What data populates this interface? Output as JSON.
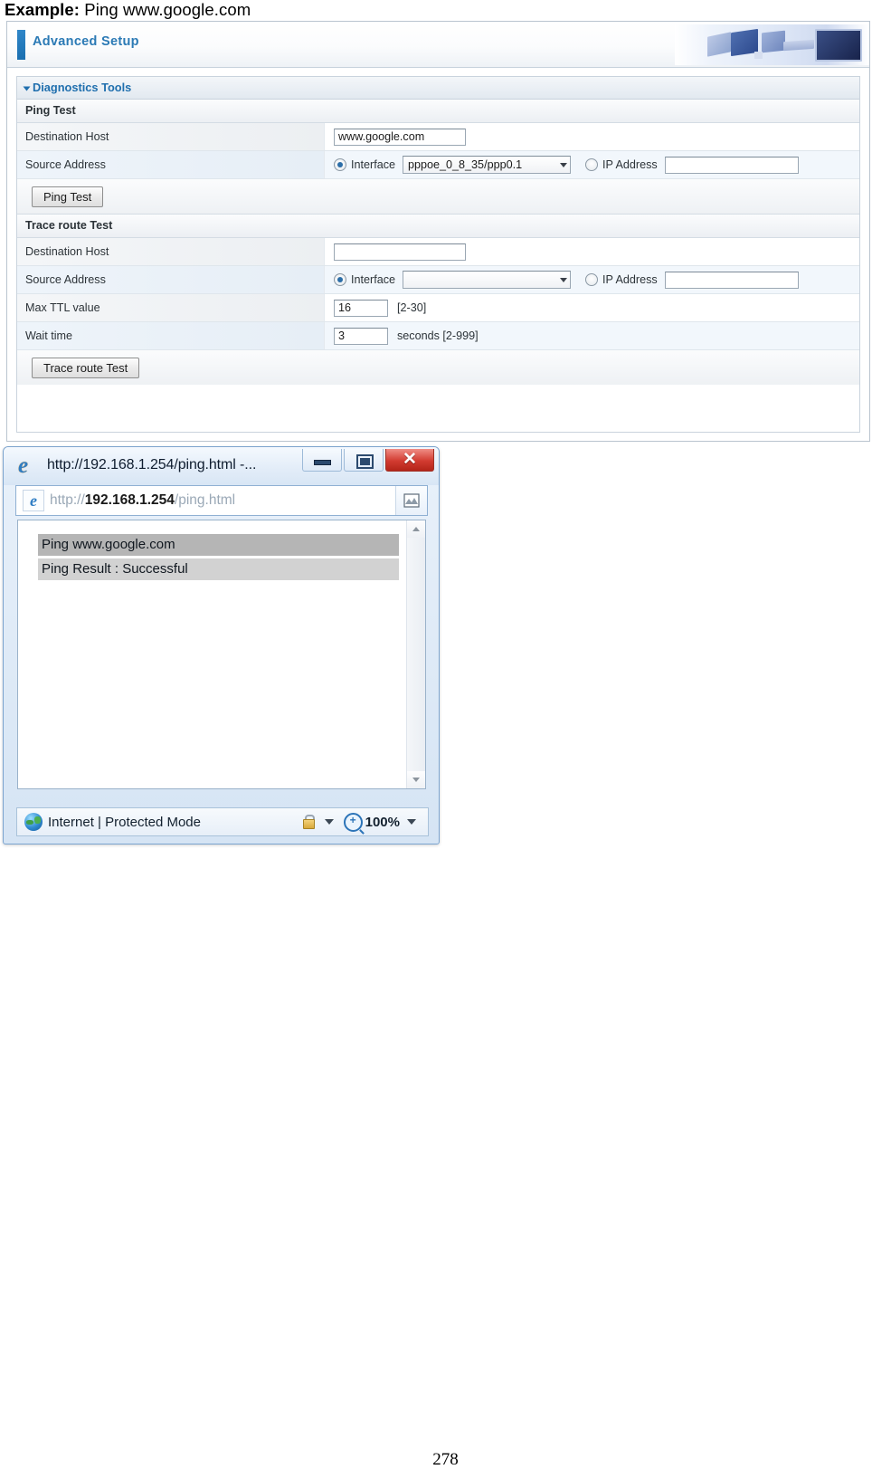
{
  "caption": {
    "bold": "Example:",
    "rest": " Ping www.google.com"
  },
  "router": {
    "header_title": "Advanced Setup",
    "section_title": "Diagnostics Tools",
    "ping_section": {
      "title": "Ping Test",
      "destination_host_label": "Destination Host",
      "destination_host_value": "www.google.com",
      "source_address_label": "Source Address",
      "interface_radio_label": "Interface",
      "interface_value": "pppoe_0_8_35/ppp0.1",
      "ip_address_radio_label": "IP Address",
      "ip_address_value": "",
      "button_label": "Ping Test"
    },
    "trace_section": {
      "title": "Trace route Test",
      "destination_host_label": "Destination Host",
      "destination_host_value": "",
      "source_address_label": "Source Address",
      "interface_radio_label": "Interface",
      "interface_value": "",
      "ip_address_radio_label": "IP Address",
      "ip_address_value": "",
      "max_ttl_label": "Max TTL value",
      "max_ttl_value": "16",
      "max_ttl_hint": "[2-30]",
      "wait_time_label": "Wait time",
      "wait_time_value": "3",
      "wait_time_hint": "seconds [2-999]",
      "button_label": "Trace route Test"
    }
  },
  "browser": {
    "title": "http://192.168.1.254/ping.html -...",
    "url_prefix": "http://",
    "url_host": "192.168.1.254",
    "url_path": "/ping.html",
    "minimize_label": "",
    "maximize_label": "",
    "close_label": "✕",
    "content": {
      "line1": "Ping www.google.com",
      "line2": "Ping Result : Successful"
    },
    "status": {
      "zone_text": "Internet | Protected Mode",
      "zoom_level": "100%"
    }
  },
  "footer": {
    "page_number": "278"
  },
  "colors": {
    "accent_blue": "#2b7ab5",
    "close_red": "#d23b30",
    "row_alt": "#f2f7fc"
  }
}
